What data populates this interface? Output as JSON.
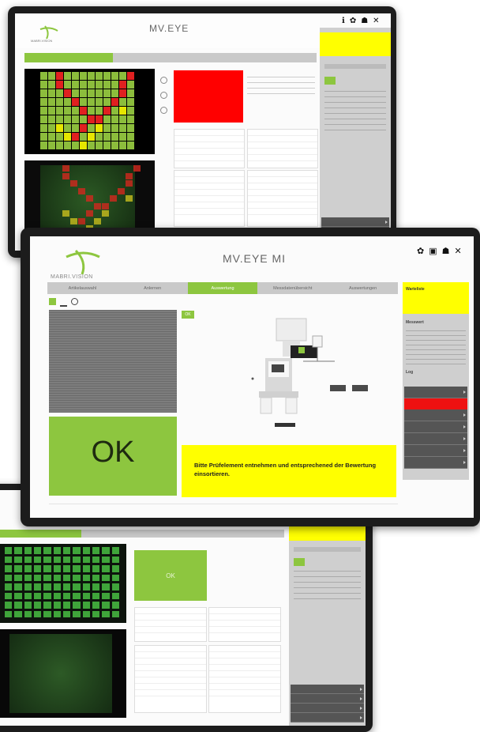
{
  "screen_top": {
    "app_title": "MV.EYE",
    "logo_text": "MABRI.VISION",
    "header_info": "",
    "tabs": [
      "",
      "",
      ""
    ],
    "status_label": "",
    "side_items": [
      "",
      "",
      "",
      "",
      ""
    ]
  },
  "screen_middle": {
    "app_title": "MV.EYE MI",
    "logo_text": "MABRI.VISION",
    "tabs": [
      "Artikelauswahl",
      "Anlernen",
      "Auswertung",
      "Messdatenübersicht",
      "Auswertungen"
    ],
    "active_tab": 2,
    "result_text": "OK",
    "result_sub": "",
    "message": "Bitte Prüfelement entnehmen und entsprechened der Bewertung einsortieren.",
    "small_badge": "OK",
    "status_header": "Warteliste",
    "side_section": "Messwert",
    "log_label": "Log",
    "side_buttons": [
      "",
      "",
      "",
      "",
      "",
      "",
      ""
    ],
    "footer": ""
  },
  "screen_bottom": {
    "logo_text": "",
    "result_text": "OK",
    "tabs": [
      "",
      "",
      "",
      ""
    ],
    "side_items": [
      "",
      "",
      "",
      ""
    ]
  },
  "icons": {
    "info": "info-icon",
    "settings": "gear-icon",
    "user": "user-icon",
    "close": "close-icon",
    "document": "document-icon"
  },
  "colors": {
    "accent_green": "#8dc63f",
    "alert_red": "#ee1111",
    "highlight_yellow": "#ffff00",
    "panel_grey": "#cfcfcf",
    "button_dark": "#555555"
  }
}
